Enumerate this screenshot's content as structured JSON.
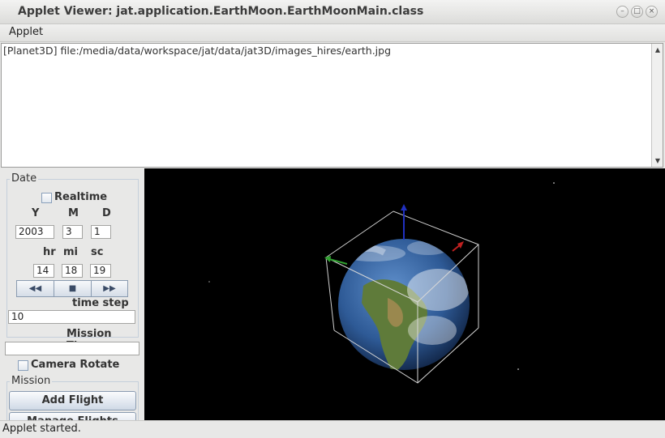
{
  "window": {
    "title": "Applet Viewer: jat.application.EarthMoon.EarthMoonMain.class"
  },
  "menubar": {
    "items": [
      "Applet"
    ]
  },
  "console": {
    "lines": [
      "[Planet3D] file:/media/data/workspace/jat/data/jat3D/images_hires/earth.jpg"
    ]
  },
  "date_panel": {
    "group_label": "Date",
    "realtime_label": "Realtime",
    "realtime_checked": false,
    "y_label": "Y",
    "m_label": "M",
    "d_label": "D",
    "year": "2003",
    "month": "3",
    "day": "1",
    "hr_label": "hr",
    "mi_label": "mi",
    "sc_label": "sc",
    "hour": "14",
    "minute": "18",
    "second": "19",
    "time_step_label": "time step",
    "time_step": "10"
  },
  "mission_time": {
    "label": "Mission Time",
    "value": ""
  },
  "camera_rotate": {
    "label": "Camera Rotate",
    "checked": false
  },
  "mission_panel": {
    "group_label": "Mission",
    "add_flight_label": "Add Flight",
    "manage_flights_label": "Manage Flights"
  },
  "statusbar": {
    "text": "Applet started."
  },
  "colors": {
    "viewport_bg": "#000000",
    "ocean": "#2e5a96",
    "land": "#5f7b3a",
    "x_axis": "#c02020",
    "y_axis": "#30a030",
    "z_axis": "#2030c0"
  }
}
